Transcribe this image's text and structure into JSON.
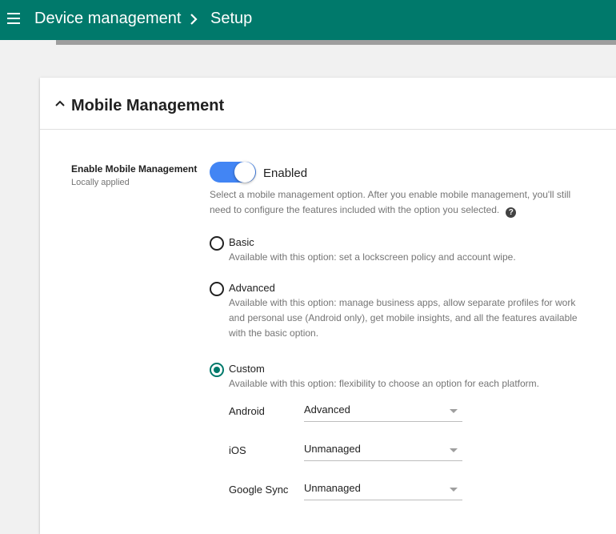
{
  "header": {
    "crumb_root": "Device management",
    "crumb_current": "Setup",
    "background": "#00796b"
  },
  "card": {
    "title": "Mobile Management"
  },
  "setting": {
    "label": "Enable Mobile Management",
    "sub": "Locally applied",
    "toggle_state": "Enabled",
    "toggle_on": true,
    "description": "Select a mobile management option. After you enable mobile management, you'll still need to configure the features included with the option you selected."
  },
  "options": [
    {
      "label": "Basic",
      "desc": "Available with this option: set a lockscreen policy and account wipe.",
      "checked": false
    },
    {
      "label": "Advanced",
      "desc": "Available with this option: manage business apps, allow separate profiles for work and personal use (Android only), get mobile insights, and all the features available with the basic option.",
      "checked": false
    },
    {
      "label": "Custom",
      "desc": "Available with this option: flexibility to choose an option for each platform.",
      "checked": true
    }
  ],
  "platforms": [
    {
      "label": "Android",
      "value": "Advanced"
    },
    {
      "label": "iOS",
      "value": "Unmanaged"
    },
    {
      "label": "Google Sync",
      "value": "Unmanaged"
    }
  ],
  "colors": {
    "accent": "#00796b",
    "toggle": "#4285f4"
  }
}
